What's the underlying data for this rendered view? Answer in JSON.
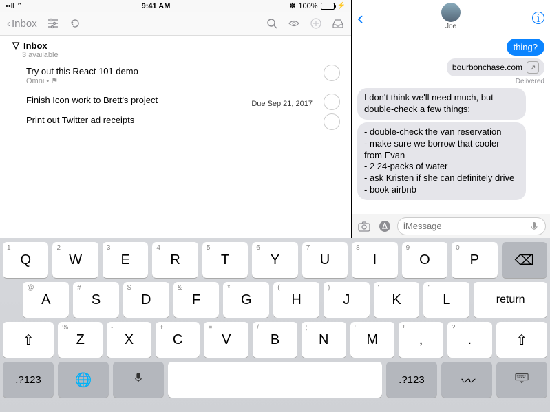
{
  "status": {
    "carrier": "••ll ⌃",
    "time": "9:41 AM",
    "bt": "✽",
    "pct": "100%"
  },
  "toolbar": {
    "back": "Inbox"
  },
  "folder": {
    "name": "Inbox",
    "count": "3 available"
  },
  "tasks": [
    {
      "title": "Try out this React 101 demo",
      "sub": "Omni • ⚑",
      "due": ""
    },
    {
      "title": "Finish Icon work to Brett's project",
      "sub": "",
      "due": "Due Sep 21, 2017"
    },
    {
      "title": "Print out Twitter ad receipts",
      "sub": "",
      "due": ""
    }
  ],
  "messages": {
    "contact": "Joe",
    "out1": "thing?",
    "link": "bourbonchase.com",
    "delivered": "Delivered",
    "in1": "I don't think we'll need much, but double-check a few things:",
    "in2": "- double-check the van reservation\n- make sure we borrow that cooler from Evan\n- 2 24-packs of water\n- ask Kristen if she can definitely drive\n- book airbnb",
    "placeholder": "iMessage"
  },
  "kb": {
    "r1": [
      [
        "1",
        "Q"
      ],
      [
        "2",
        "W"
      ],
      [
        "3",
        "E"
      ],
      [
        "4",
        "R"
      ],
      [
        "5",
        "T"
      ],
      [
        "6",
        "Y"
      ],
      [
        "7",
        "U"
      ],
      [
        "8",
        "I"
      ],
      [
        "9",
        "O"
      ],
      [
        "0",
        "P"
      ]
    ],
    "r2": [
      [
        "@",
        "A"
      ],
      [
        "#",
        "S"
      ],
      [
        "$",
        "D"
      ],
      [
        "&",
        "F"
      ],
      [
        "*",
        "G"
      ],
      [
        "(",
        "H"
      ],
      [
        ")",
        "J"
      ],
      [
        "'",
        "K"
      ],
      [
        "\"",
        "L"
      ]
    ],
    "r2return": "return",
    "r3": [
      [
        "%",
        "Z"
      ],
      [
        "-",
        "X"
      ],
      [
        "+",
        "C"
      ],
      [
        "=",
        "V"
      ],
      [
        "/",
        "B"
      ],
      [
        ";",
        "N"
      ],
      [
        ":",
        "M"
      ],
      [
        "!",
        ","
      ],
      [
        "?",
        "."
      ]
    ],
    "r4sym": ".?123"
  }
}
